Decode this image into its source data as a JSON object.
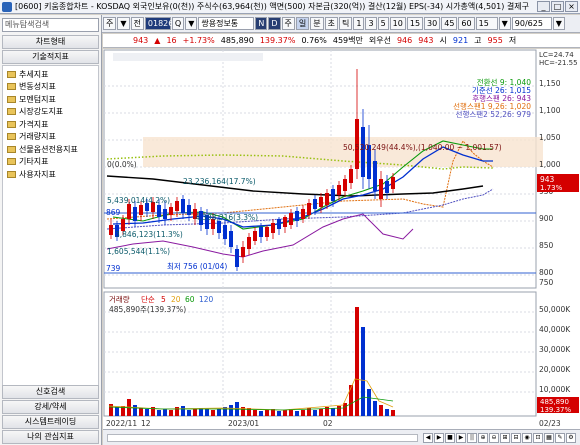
{
  "window": {
    "title": "[0600] 키움종합차트 - KOSDAQ 외국인보유(0(천)) 주식수(63,964(천)) 액면(500) 자본금(320(억)) 결산(12월) EPS(-34) 시가총액(4,501) 결제구",
    "buttons": [
      "_",
      "□",
      "×"
    ]
  },
  "toolbar": {
    "items": [
      "주",
      "▼",
      "전",
      "018260",
      "Q",
      "▼",
      "쌍용정보통",
      "N",
      "D",
      "주",
      "일",
      "분",
      "초",
      "틱",
      "1",
      "3",
      "5",
      "10",
      "15",
      "30",
      "45",
      "60",
      "15",
      "▼",
      "90/625",
      "▼"
    ],
    "count": "90/625"
  },
  "quote": {
    "items": [
      {
        "t": "943",
        "c": "red"
      },
      {
        "t": "▲",
        "c": "red"
      },
      {
        "t": "16",
        "c": "red"
      },
      {
        "t": "+1.73%",
        "c": "red"
      },
      {
        "t": "485,890",
        "c": ""
      },
      {
        "t": "139.37%",
        "c": "red"
      },
      {
        "t": "0.76%",
        "c": ""
      },
      {
        "t": "459백만",
        "c": ""
      },
      {
        "t": "외우선",
        "c": ""
      },
      {
        "t": "946",
        "c": "red"
      },
      {
        "t": "943",
        "c": "red"
      },
      {
        "t": "시",
        "c": ""
      },
      {
        "t": "921",
        "c": "blue2"
      },
      {
        "t": "고",
        "c": ""
      },
      {
        "t": "955",
        "c": "red"
      },
      {
        "t": "저",
        "c": ""
      }
    ]
  },
  "sidebar": {
    "search": "메뉴탐색검색",
    "chart_form": "차트형태",
    "indicators": "기술적지표",
    "items": [
      "추세지표",
      "변동성지표",
      "모멘텀지표",
      "시장강도지표",
      "가격지표",
      "거래량지표",
      "선물옵션전용지표",
      "기타지표",
      "사용자지표"
    ],
    "bottom": [
      "신호검색",
      "강세/약세",
      "시스템트레이딩",
      "나의 관심지표"
    ]
  },
  "chart": {
    "legend": [
      {
        "t": "전환선 9: 1,040",
        "c": "#0a9a0a"
      },
      {
        "t": "기준선 26: 1,015",
        "c": "#0030d0"
      },
      {
        "t": "후행스팬 26: 943",
        "c": "#8a1aa0"
      },
      {
        "t": "선행스팬1 9,26: 1,020",
        "c": "#e07010"
      },
      {
        "t": "선행스팬2 52,26: 979",
        "c": "#5050c0"
      }
    ],
    "price_labels": [
      "1,150",
      "1,100",
      "1,050",
      "1,000",
      "950",
      "900",
      "850",
      "800",
      "750"
    ],
    "right_tags": [
      "LC=24.74",
      "HC=-21.55",
      "943",
      "1.73%"
    ],
    "annotations": [
      "50,520,249(44.4%),(1,040.00 ~ 1,001.57)",
      "0(0.0%)",
      "23,236,164(17.7%)",
      "5,439,014(4.2%)",
      "3,846,123(11.3%)",
      "4,398,316(3.3%)",
      "1,605,544(1.1%)",
      "최저 756 (01/04)",
      "869",
      "739"
    ],
    "vol_legend": [
      "거래량",
      "단순",
      "5",
      "20",
      "60",
      "120"
    ],
    "vol_text": "485,890주(139.37%)",
    "vol_labels": [
      "50,000K",
      "40,000K",
      "30,000K",
      "20,000K",
      "10,000K"
    ],
    "vol_tags": [
      "485,890",
      "139.37%"
    ],
    "dates": [
      "2022/11",
      "12",
      "2023/01",
      "02",
      "02/23"
    ]
  },
  "chart_data": {
    "type": "candlestick",
    "ylim": [
      720,
      1180
    ],
    "close_last": 943,
    "low_min": 756,
    "volume_ylim": [
      0,
      55000
    ],
    "volume_units": "K"
  },
  "bottombar": {
    "items": [
      "◀",
      "▶",
      "■",
      "▶",
      "||",
      "⊕",
      "⊖",
      "⊞",
      "⊟",
      "◉",
      "⊡",
      "▦",
      "✎",
      "⚙"
    ]
  }
}
